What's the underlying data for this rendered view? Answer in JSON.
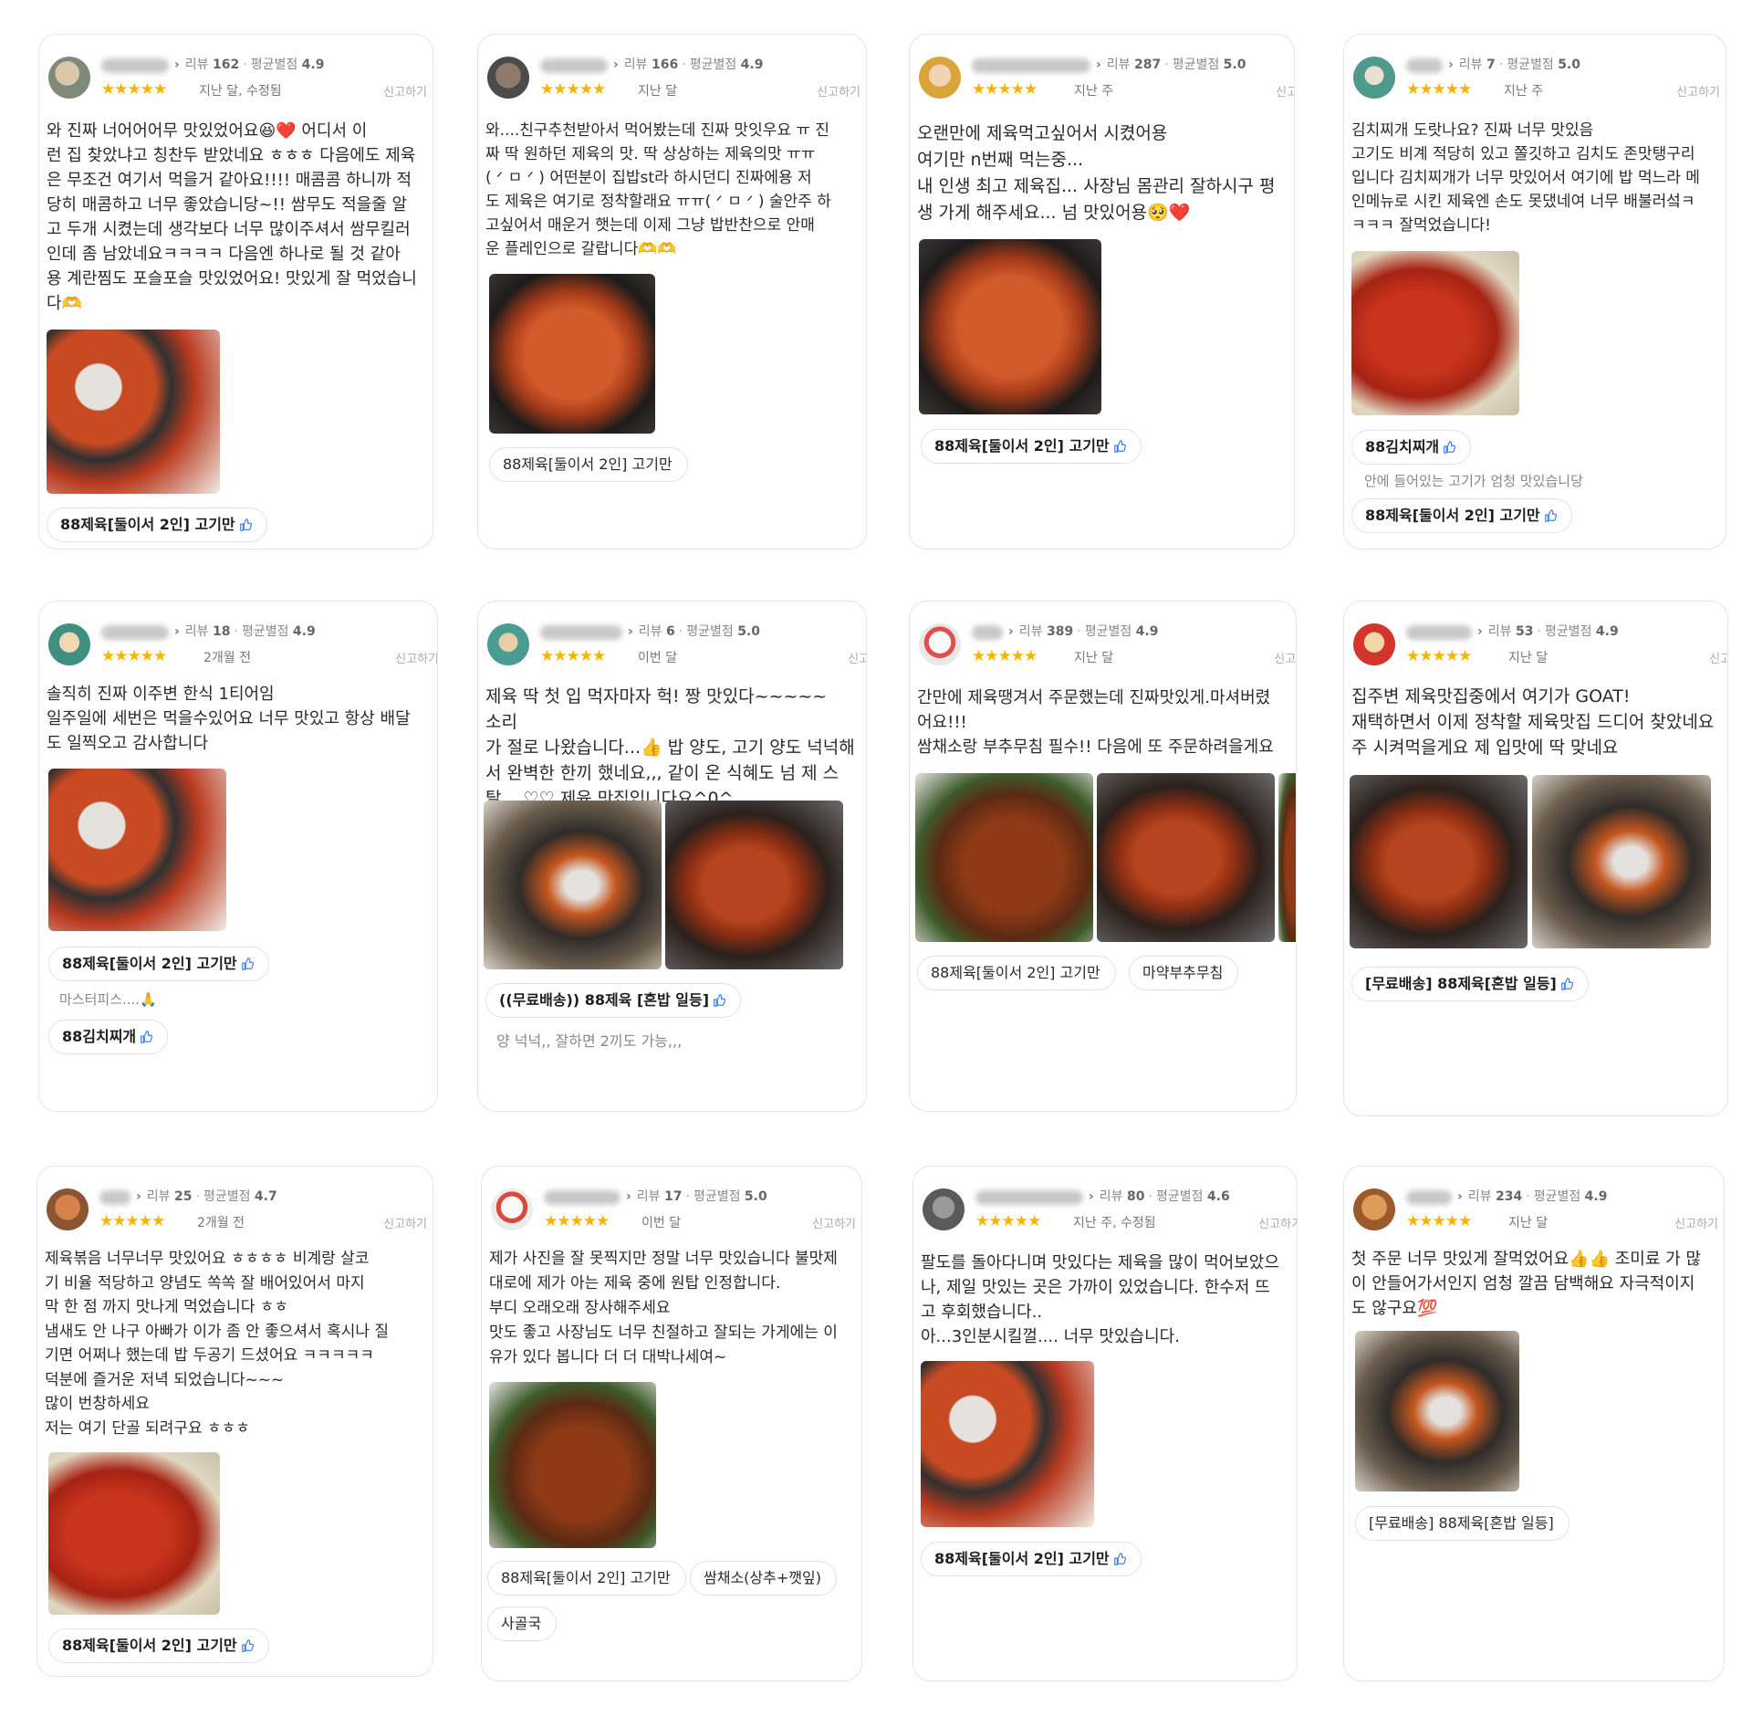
{
  "common": {
    "report_label": "신고하기",
    "stars": "★★★★★",
    "review_prefix": "리뷰",
    "avg_prefix": "평균별점"
  },
  "cards": [
    {
      "review_count": "162",
      "avg": "4.9",
      "when": "지난 달, 수정됨",
      "text": "와 진짜 너어어어무 맛있었어요😆❤️ 어디서 이\n런 집 찾았냐고 칭찬두 받았네요 ㅎㅎㅎ 다음에도 제육\n은 무조건 여기서 먹을거 같아요!!!! 매콤콤 하니까 적\n당히 매콤하고 너무 좋았습니당~!! 쌈무도 적을줄 알\n고 두개 시켰는데 생각보다 너무 많이주셔서 쌈무킬러\n인데 좀 남았네요ㅋㅋㅋㅋ 다음엔 하나로 될 것 같아\n용 계란찜도 포슬포슬 맛있었어요! 맛있게 잘 먹었습니\n다🫶",
      "tags": [
        "88제육[둘이서 2인] 고기만"
      ]
    },
    {
      "review_count": "166",
      "avg": "4.9",
      "when": "지난 달",
      "text": "와....친구추천받아서 먹어봤는데 진짜 맛잇우요 ㅠ 진\n짜 딱 원하던 제육의 맛. 딱 상상하는 제육의맛 ㅠㅠ\n( ᐟ ㅁ ᐟ ) 어떤분이 집밥st라 하시던디 진짜에용 저\n도 제육은 여기로 정착할래요 ㅠㅠ( ᐟ ㅁ ᐟ ) 술안주 하\n고싶어서 매운거 햇는데 이제 그냥 밥반찬으로 안매\n운 플레인으로 갈랍니다🫶🫶",
      "tags": [
        "88제육[둘이서 2인] 고기만"
      ]
    },
    {
      "review_count": "287",
      "avg": "5.0",
      "when": "지난 주",
      "text": "오랜만에 제육먹고싶어서 시켰어용\n여기만 n번째 먹는중...\n내 인생 최고 제육집... 사장님 몸관리 잘하시구 평\n생 가게 해주세요... 넘 맛있어용🥺❤️",
      "tags": [
        "88제육[둘이서 2인] 고기만"
      ]
    },
    {
      "review_count": "7",
      "avg": "5.0",
      "when": "지난 주",
      "text": "김치찌개 도랏나요? 진짜 너무 맛있음\n고기도 비계 적당히 있고 쫄깃하고 김치도 존맛탱구리\n입니다 김치찌개가 너무 맛있어서 여기에 밥 먹느라 메\n인메뉴로 시킨 제육엔 손도 못댔네여 너무 배불러섴ㅋ\nㅋㅋㅋ 잘먹었습니다!",
      "tags": [
        "88김치찌개",
        "88제육[둘이서 2인] 고기만"
      ],
      "sub": "안에 들어있는 고기가 엄청 맛있습니당"
    },
    {
      "review_count": "18",
      "avg": "4.9",
      "when": "2개월 전",
      "text": "솔직히 진짜 이주변 한식 1티어임\n일주일에 세번은 먹을수있어요 너무 맛있고 항상 배달\n도 일찍오고 감사합니다",
      "tags": [
        "88제육[둘이서 2인] 고기만",
        "88김치찌개"
      ],
      "sub": "마스터피스....🙏"
    },
    {
      "review_count": "6",
      "avg": "5.0",
      "when": "이번 달",
      "text": "제육 딱 첫 입 먹자마자 헉! 짱 맛있다~~~~~ 소리\n가 절로 나왔습니다...👍 밥 양도, 고기 양도 넉넉해\n서 완벽한 한끼 했네요,,, 같이 온 식혜도 넘 제 스\n탈,,, ♡♡ 제육 맛집입니다요^0^",
      "tags": [
        "((무료배송)) 88제육 [혼밥 일등]"
      ],
      "sub": "양 넉넉,, 잘하면 2끼도 가능,,,"
    },
    {
      "review_count": "389",
      "avg": "4.9",
      "when": "지난 달",
      "text": "간만에 제육땡겨서 주문했는데 진짜맛있게.마셔버렸\n어요!!!\n쌈채소랑 부추무침 필수!! 다음에 또 주문하려을게요",
      "tags": [
        "88제육[둘이서 2인] 고기만",
        "마약부추무침"
      ]
    },
    {
      "review_count": "53",
      "avg": "4.9",
      "when": "지난 달",
      "text": "집주변 제육맛집중에서 여기가 GOAT!\n재택하면서 이제 정착할 제육맛집 드디어 찾았네요\n주 시켜먹을게요 제 입맛에 딱 맞네요",
      "tags": [
        "[무료배송] 88제육[혼밥 일등]"
      ]
    },
    {
      "review_count": "25",
      "avg": "4.7",
      "when": "2개월 전",
      "text": "제육볶음 너무너무 맛있어요 ㅎㅎㅎㅎ 비계랑 살코\n기 비율 적당하고 양념도 쏙쏙 잘 배어있어서 마지\n막 한 점 까지 맛나게 먹었습니다 ㅎㅎ\n냄새도 안 나구 아빠가 이가 좀 안 좋으셔서 혹시나 질\n기면 어쩌나 했는데 밥 두공기 드셨어요 ㅋㅋㅋㅋㅋ\n덕분에 즐거운 저녁 되었습니다~~~\n많이 번창하세요\n저는 여기 단골 되려구요 ㅎㅎㅎ",
      "tags": [
        "88제육[둘이서 2인] 고기만"
      ]
    },
    {
      "review_count": "17",
      "avg": "5.0",
      "when": "이번 달",
      "text": "제가 사진을 잘 못찍지만 정말 너무 맛있습니다 불맛제\n대로에 제가 아는 제육 중에 원탑 인정합니다.\n부디 오래오래 장사해주세요\n맛도 좋고 사장님도 너무 친절하고 잘되는 가게에는 이\n유가 있다 봅니다 더 더 대박나세여~",
      "tags": [
        "88제육[둘이서 2인] 고기만",
        "쌈채소(상추+깻잎)",
        "사골국"
      ]
    },
    {
      "review_count": "80",
      "avg": "4.6",
      "when": "지난 주, 수정됨",
      "text": "팔도를 돌아다니며 맛있다는 제육을 많이 먹어보았으\n나, 제일 맛있는 곳은 가까이 있었습니다. 한수저 뜨\n고 후회했습니다..\n아...3인분시킬껄.... 너무 맛있습니다.",
      "tags": [
        "88제육[둘이서 2인] 고기만"
      ]
    },
    {
      "review_count": "234",
      "avg": "4.9",
      "when": "지난 달",
      "text": "첫 주문 너무 맛있게 잘먹었어요👍👍 조미료 가 많\n이 안들어가서인지 엄청 깔끔 담백해요 자극적이지\n도 않구요💯",
      "tags": [
        "[무료배송] 88제육[혼밥 일등]"
      ]
    }
  ]
}
